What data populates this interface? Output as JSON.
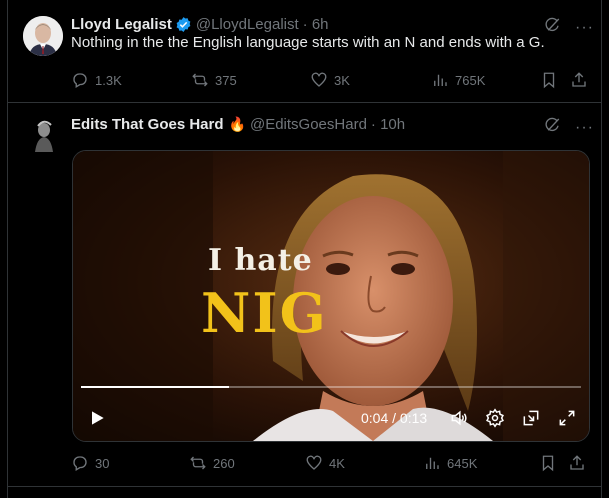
{
  "tweets": [
    {
      "author": "Lloyd Legalist",
      "handle": "@LloydLegalist",
      "time": "· 6h",
      "text": "Nothing in the the English language starts with an N and ends with a G.",
      "verified": true,
      "replies": "1.3K",
      "reposts": "375",
      "likes": "3K",
      "views": "765K"
    },
    {
      "author": "Edits That Goes Hard",
      "emoji": "🔥",
      "handle": "@EditsGoesHard",
      "time": "· 10h",
      "replies": "30",
      "reposts": "260",
      "likes": "4K",
      "views": "645K",
      "video": {
        "caption_line1": "I hate",
        "caption_line2": "NIG",
        "time_display": "0:04 / 0:13",
        "progress": 0.295
      }
    }
  ],
  "colors": {
    "verified": "#1d9bf0",
    "muted": "#71767b",
    "caption_gold": "#f2c21a"
  }
}
